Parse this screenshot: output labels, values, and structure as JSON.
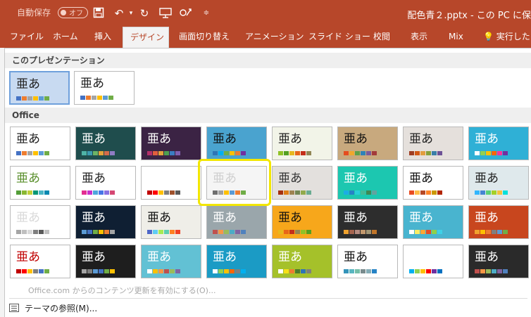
{
  "titlebar": {
    "autosave_label": "自動保存",
    "autosave_state": "オフ",
    "doc_title": "配色青２.pptx - この PC に保"
  },
  "tabs": [
    "ファイル",
    "ホーム",
    "挿入",
    "デザイン",
    "画面切り替え",
    "アニメーション",
    "スライド ショー",
    "校閲",
    "表示",
    "Mix",
    "実行したい"
  ],
  "active_tab": "デザイン",
  "gallery": {
    "this_presentation_header": "このプレゼンテーション",
    "office_header": "Office",
    "sample_text": "亜あ",
    "this_presentation_themes": [
      {
        "bg": "#d6e6f7",
        "text": "#222222",
        "sw": [
          "#4472c4",
          "#ed7d31",
          "#a5a5a5",
          "#ffc000",
          "#5b9bd5",
          "#70ad47"
        ]
      },
      {
        "bg": "#ffffff",
        "text": "#222222",
        "sw": [
          "#4472c4",
          "#ed7d31",
          "#a5a5a5",
          "#ffc000",
          "#5b9bd5",
          "#70ad47"
        ]
      }
    ],
    "office_themes": [
      {
        "bg": "#ffffff",
        "text": "#222",
        "sw": [
          "#4472c4",
          "#ed7d31",
          "#a5a5a5",
          "#ffc000",
          "#5b9bd5",
          "#70ad47"
        ]
      },
      {
        "bg": "#1f4d4d",
        "text": "#fff",
        "sw": [
          "#4fb3a6",
          "#3c9bb0",
          "#6cb466",
          "#e2a33a",
          "#d26b4a",
          "#8e7cc3"
        ]
      },
      {
        "bg": "#3b2344",
        "text": "#fff",
        "sw": [
          "#b4306a",
          "#e25e3d",
          "#e3a23a",
          "#4e9f50",
          "#3a7dc2",
          "#7f5fb0"
        ]
      },
      {
        "bg": "#4aa3cf",
        "text": "#111",
        "sw": [
          "#2e75b6",
          "#00b0f0",
          "#70ad47",
          "#ffc000",
          "#ed7d31",
          "#7030a0"
        ]
      },
      {
        "bg": "#f2f4e8",
        "text": "#222",
        "sw": [
          "#90c226",
          "#54a021",
          "#e6b91e",
          "#e76618",
          "#c42f1a",
          "#918655"
        ]
      },
      {
        "bg": "#c8a97e",
        "text": "#111",
        "sw": [
          "#e54c1f",
          "#f0a72c",
          "#5e9f4a",
          "#2e83b8",
          "#7a5a9c",
          "#a33a3a"
        ]
      },
      {
        "bg": "#e5e0dc",
        "text": "#222",
        "sw": [
          "#9e3d22",
          "#d25814",
          "#e29d3e",
          "#86a03a",
          "#3a7fa8",
          "#6d5296"
        ]
      },
      {
        "bg": "#2fb0d6",
        "text": "#fff",
        "sw": [
          "#ffffff",
          "#92d050",
          "#ffc000",
          "#ff6600",
          "#ff3399",
          "#7030a0"
        ]
      },
      {
        "bg": "#ffffff",
        "text": "#5a8f2c",
        "sw": [
          "#549e39",
          "#8ab833",
          "#c0cf3a",
          "#029676",
          "#4ab5c4",
          "#0989b1"
        ]
      },
      {
        "bg": "#ffffff",
        "text": "#222",
        "sw": [
          "#e32d91",
          "#c830cc",
          "#4ea6dc",
          "#4775e7",
          "#8971e1",
          "#d54773"
        ]
      },
      {
        "bg": "#ffffff",
        "text": "#fff",
        "sw": [
          "#c00000",
          "#ff0000",
          "#ffc000",
          "#7f7f7f",
          "#a0522d",
          "#595959"
        ]
      },
      {
        "bg": "#f5f5f5",
        "text": "#cfcfcf",
        "sw": [
          "#6f6f6f",
          "#a0a0a0",
          "#ffc000",
          "#5b9bd5",
          "#ed7d31",
          "#70ad47"
        ]
      },
      {
        "bg": "#e3e0dd",
        "text": "#333",
        "sw": [
          "#a53010",
          "#de7e18",
          "#9f8351",
          "#728653",
          "#92aa4c",
          "#6aac91"
        ]
      },
      {
        "bg": "#1cc7b0",
        "text": "#fff",
        "sw": [
          "#1cade4",
          "#2683c6",
          "#27ced7",
          "#42ba97",
          "#3e8853",
          "#62a39f"
        ]
      },
      {
        "bg": "#ffffff",
        "text": "#111",
        "sw": [
          "#e84c22",
          "#ffbd47",
          "#b64926",
          "#ff8427",
          "#cc9900",
          "#b22600"
        ]
      },
      {
        "bg": "#dfe9ec",
        "text": "#222",
        "sw": [
          "#31b6fd",
          "#4584d3",
          "#5bd078",
          "#a5d028",
          "#f5c040",
          "#05e0db"
        ]
      },
      {
        "bg": "#ffffff",
        "text": "#d9d9d9",
        "sw": [
          "#a5a5a5",
          "#bfbfbf",
          "#d9d9d9",
          "#7f7f7f",
          "#595959",
          "#c0c0c0"
        ]
      },
      {
        "bg": "#0f1f33",
        "text": "#fff",
        "sw": [
          "#5b9bd5",
          "#4472c4",
          "#70ad47",
          "#ffc000",
          "#ed7d31",
          "#a5a5a5"
        ]
      },
      {
        "bg": "#efeee8",
        "text": "#111",
        "sw": [
          "#4e67c8",
          "#5eccf3",
          "#a7ea52",
          "#5dceaf",
          "#ff8021",
          "#f14124"
        ]
      },
      {
        "bg": "#9aa6ab",
        "text": "#fff",
        "sw": [
          "#c0504d",
          "#f79646",
          "#9bbb59",
          "#4bacc6",
          "#8064a2",
          "#4f81bd"
        ]
      },
      {
        "bg": "#f7a71b",
        "text": "#111",
        "sw": [
          "#e6b91e",
          "#e76618",
          "#c42f1a",
          "#918655",
          "#90c226",
          "#54a021"
        ]
      },
      {
        "bg": "#2d2d2d",
        "text": "#fff",
        "sw": [
          "#f0a22e",
          "#a5644e",
          "#b58b80",
          "#c3986d",
          "#a19574",
          "#c17529"
        ]
      },
      {
        "bg": "#49b4cf",
        "text": "#fff",
        "sw": [
          "#ffffff",
          "#f9ec64",
          "#ffa733",
          "#e84c22",
          "#8dd14b",
          "#3ed1e6"
        ]
      },
      {
        "bg": "#c8461e",
        "text": "#fff",
        "sw": [
          "#f0a22e",
          "#ffc000",
          "#ed7d31",
          "#7f7f7f",
          "#5b9bd5",
          "#70ad47"
        ]
      },
      {
        "bg": "#ffffff",
        "text": "#c00000",
        "sw": [
          "#c00000",
          "#ff0000",
          "#ffc000",
          "#7f7f7f",
          "#4472c4",
          "#70ad47"
        ]
      },
      {
        "bg": "#1e1e1e",
        "text": "#fff",
        "sw": [
          "#a5a5a5",
          "#7f7f7f",
          "#5b9bd5",
          "#4472c4",
          "#70ad47",
          "#ffc000"
        ]
      },
      {
        "bg": "#62c1d4",
        "text": "#fff",
        "sw": [
          "#ffffff",
          "#ffc000",
          "#f79646",
          "#c0504d",
          "#9bbb59",
          "#8064a2"
        ]
      },
      {
        "bg": "#1b9bc5",
        "text": "#fff",
        "sw": [
          "#ffffff",
          "#92d050",
          "#ffc000",
          "#ff6600",
          "#7f7f7f",
          "#00b0f0"
        ]
      },
      {
        "bg": "#a5c12a",
        "text": "#fff",
        "sw": [
          "#ffffff",
          "#f7e017",
          "#ed7d31",
          "#4a7c2f",
          "#2e75b6",
          "#7f7f7f"
        ]
      },
      {
        "bg": "#ffffff",
        "text": "#111",
        "sw": [
          "#3494ba",
          "#58b6c0",
          "#75bda7",
          "#7a8c8e",
          "#84acb6",
          "#2683c6"
        ]
      },
      {
        "bg": "#ffffff",
        "text": "#fff",
        "sw": [
          "#00b0f0",
          "#92d050",
          "#ffc000",
          "#ff0000",
          "#7030a0",
          "#0070c0"
        ]
      },
      {
        "bg": "#2a2a2a",
        "text": "#fff",
        "sw": [
          "#c0504d",
          "#f79646",
          "#9bbb59",
          "#4bacc6",
          "#8064a2",
          "#4f81bd"
        ]
      }
    ]
  },
  "footer": {
    "office_com_text": "Office.com からのコンテンツ更新を有効にする(O)...",
    "browse_themes": "テーマの参照(M)..."
  },
  "colors": {
    "accent": "#b7472a",
    "highlight": "#f2e600"
  }
}
